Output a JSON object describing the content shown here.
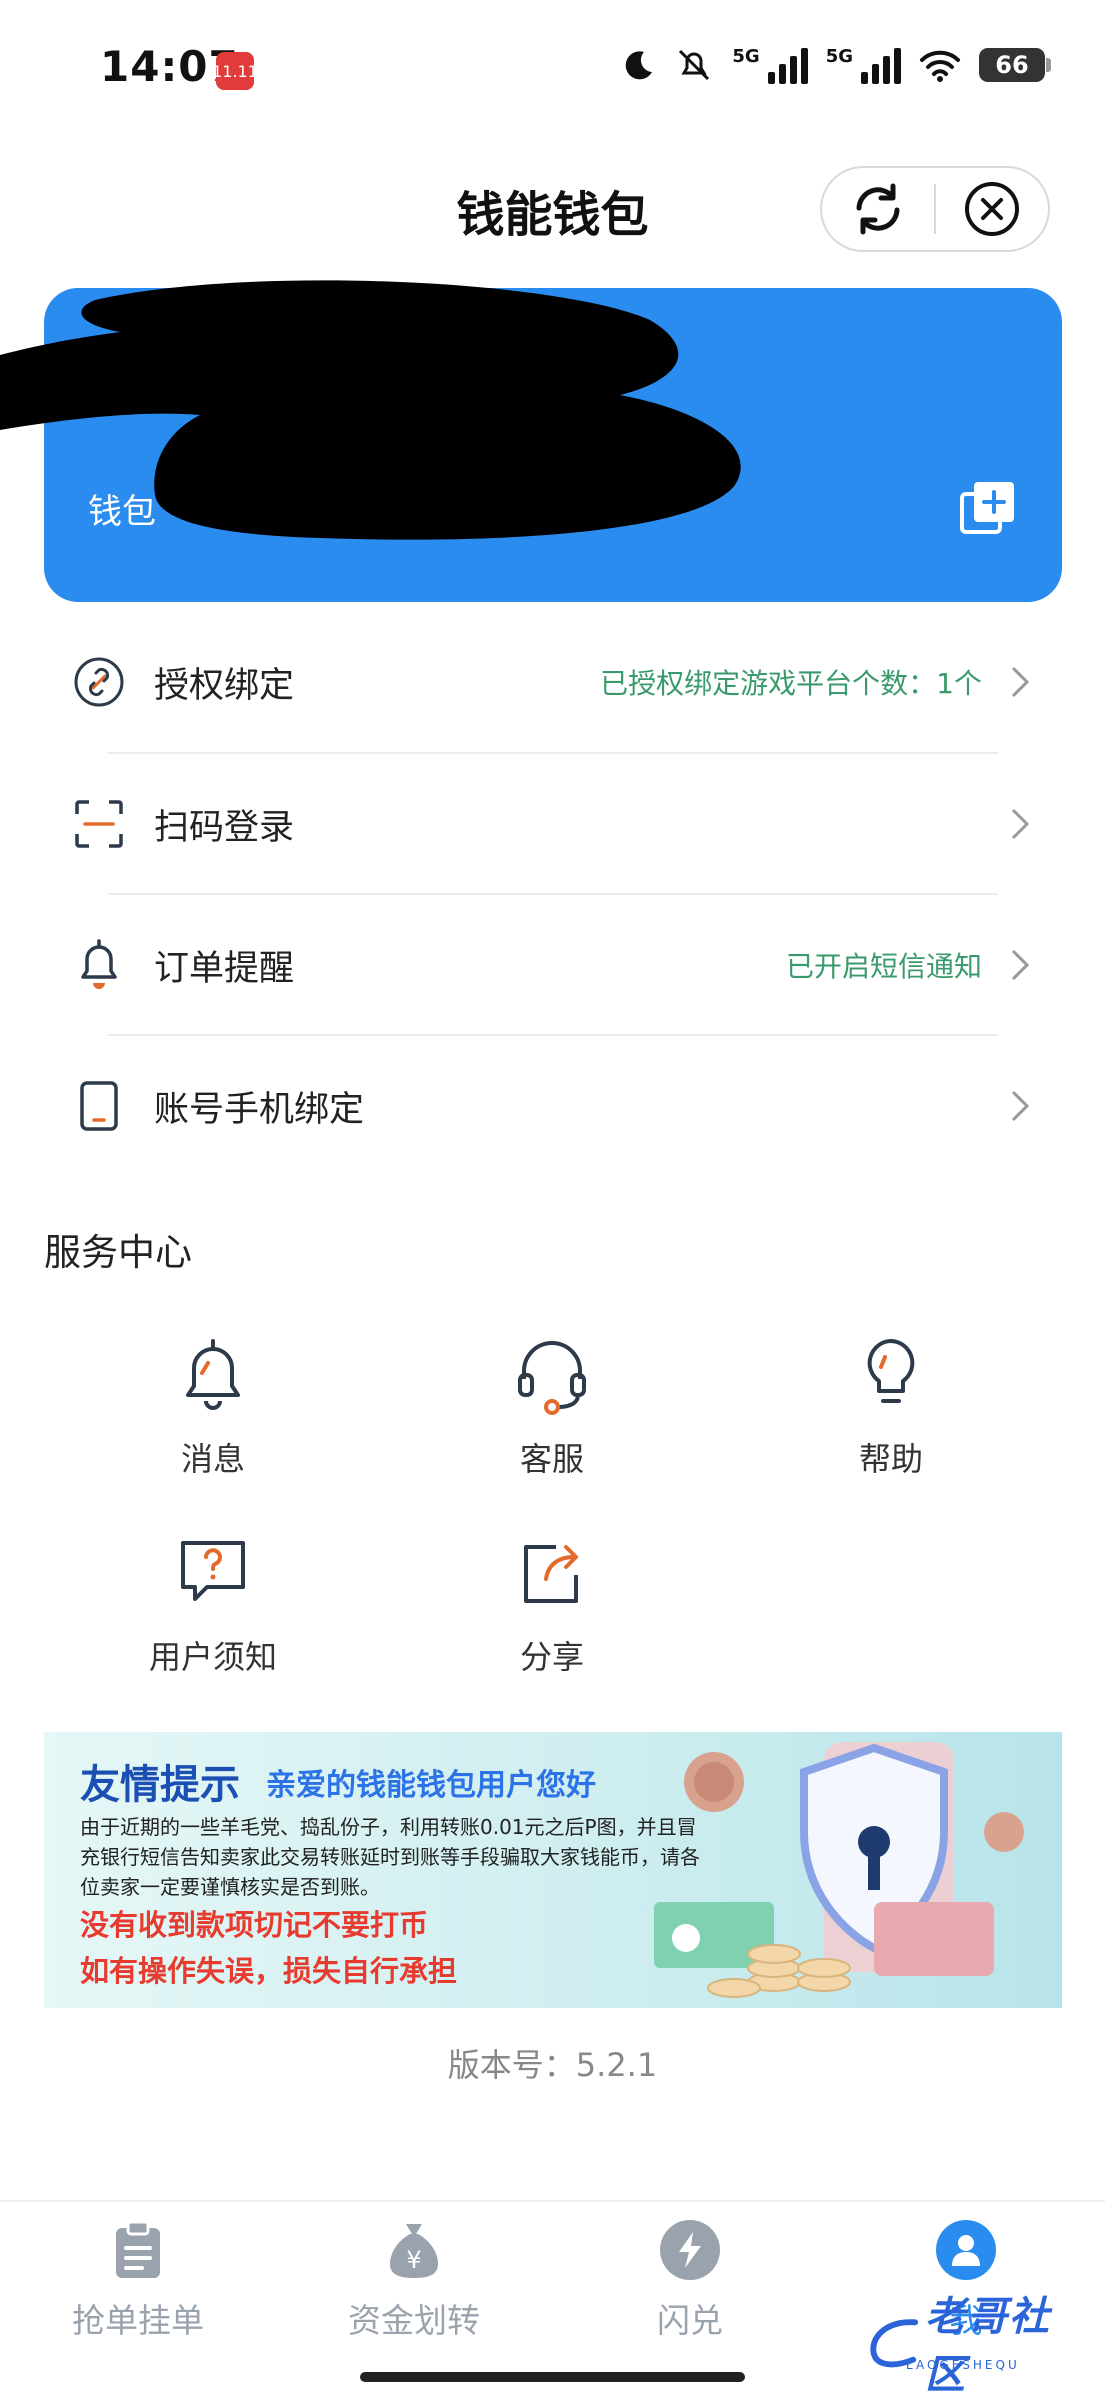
{
  "status_bar": {
    "time": "14:07",
    "app_badge_text": "11.11",
    "network_1": "5G",
    "network_2": "5G",
    "battery": "66"
  },
  "header": {
    "title": "钱能钱包"
  },
  "wallet_card": {
    "label": "钱包",
    "color": "#2b8cf0"
  },
  "menu": [
    {
      "label": "授权绑定",
      "value": "已授权绑定游戏平台个数：1个",
      "icon": "link-icon"
    },
    {
      "label": "扫码登录",
      "value": "",
      "icon": "scan-icon"
    },
    {
      "label": "订单提醒",
      "value": "已开启短信通知",
      "icon": "bell-icon"
    },
    {
      "label": "账号手机绑定",
      "value": "",
      "icon": "phone-icon"
    }
  ],
  "services": {
    "title": "服务中心",
    "items": [
      {
        "label": "消息",
        "icon": "bell-icon"
      },
      {
        "label": "客服",
        "icon": "headset-icon"
      },
      {
        "label": "帮助",
        "icon": "lightbulb-icon"
      },
      {
        "label": "用户须知",
        "icon": "question-bubble-icon"
      },
      {
        "label": "分享",
        "icon": "share-icon"
      }
    ]
  },
  "banner": {
    "title": "友情提示",
    "subtitle": "亲爱的钱能钱包用户您好",
    "body": "由于近期的一些羊毛党、捣乱份子，利用转账0.01元之后P图，并且冒充银行短信告知卖家此交易转账延时到账等手段骗取大家钱能币，请各位卖家一定要谨慎核实是否到账。",
    "warning_1": "没有收到款项切记不要打币",
    "warning_2": "如有操作失误，损失自行承担"
  },
  "version": "版本号：5.2.1",
  "bottom_nav": {
    "tabs": [
      {
        "label": "抢单挂单",
        "icon": "clipboard-icon",
        "active": false
      },
      {
        "label": "资金划转",
        "icon": "money-bag-icon",
        "active": false
      },
      {
        "label": "闪兑",
        "icon": "lightning-icon",
        "active": false
      },
      {
        "label": "我",
        "icon": "user-icon",
        "active": true
      }
    ],
    "active_color": "#2b8cf0"
  },
  "watermark": {
    "text": "老哥社区",
    "sub": "LAOGESHEQU"
  }
}
